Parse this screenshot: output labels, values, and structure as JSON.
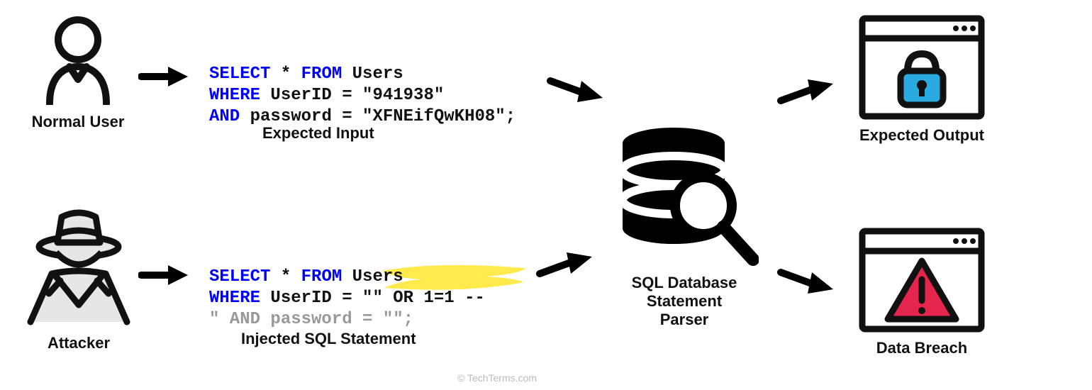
{
  "labels": {
    "normal_user": "Normal User",
    "attacker": "Attacker",
    "expected_input": "Expected Input",
    "injected_statement": "Injected SQL Statement",
    "db_parser": "SQL Database\nStatement\nParser",
    "expected_output": "Expected Output",
    "data_breach": "Data Breach",
    "watermark": "© TechTerms.com"
  },
  "sql": {
    "normal": {
      "l1a": "SELECT",
      "l1b": " * ",
      "l1c": "FROM",
      "l1d": " Users",
      "l2a": "WHERE",
      "l2b": " UserID = ",
      "l2c": "\"941938\"",
      "l3a": "AND",
      "l3b": " password = ",
      "l3c": "\"XFNEifQwKH08\"",
      "l3d": ";"
    },
    "attack": {
      "l1a": "SELECT",
      "l1b": " * ",
      "l1c": "FROM",
      "l1d": " Users",
      "l2a": "WHERE",
      "l2b": " UserID = ",
      "l2c": "\"\" OR 1=1 --",
      "l3": "\" AND password = \"\";"
    }
  },
  "colors": {
    "highlight": "#ffe838",
    "lock_blue": "#29abe2",
    "alert_red": "#e6254d",
    "attacker_fill": "#E6E6E6"
  }
}
